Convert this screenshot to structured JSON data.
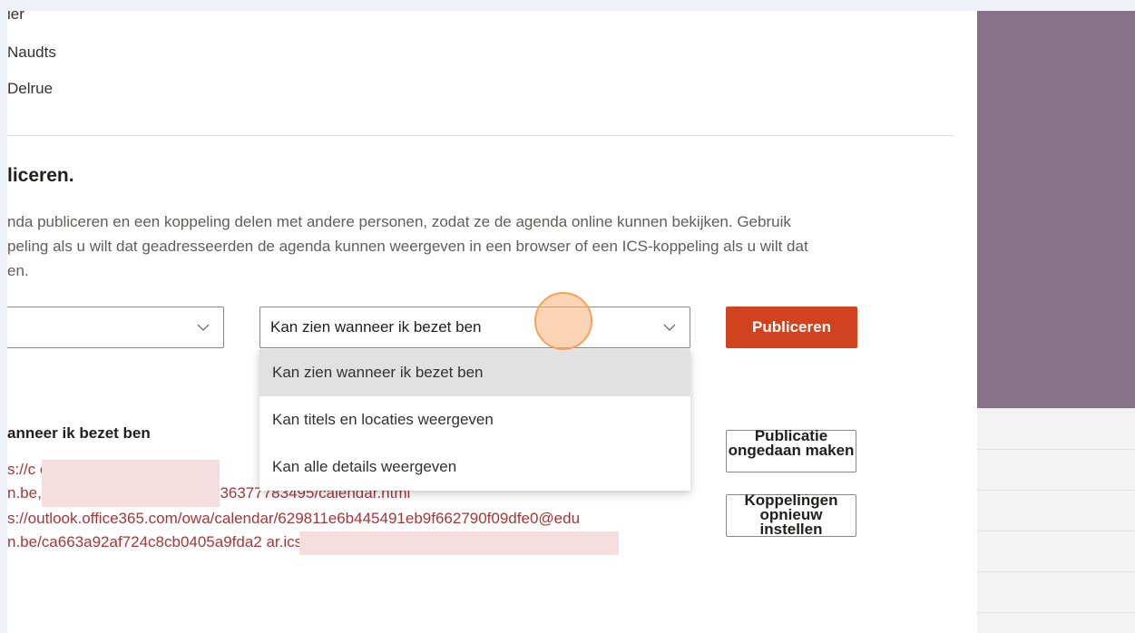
{
  "people": [
    "ier",
    "Naudts",
    "Delrue"
  ],
  "section": {
    "heading": "liceren.",
    "description": [
      "nda publiceren en een koppeling delen met andere personen, zodat ze de agenda online kunnen bekijken. Gebruik",
      "peling als u wilt dat geadresseerden de agenda kunnen weergeven in een browser of een ICS-koppeling als u wilt dat",
      "en."
    ]
  },
  "calendar_select": {
    "value": ""
  },
  "permission_select": {
    "value": "Kan zien wanneer ik bezet ben"
  },
  "publish_button": "Publiceren",
  "dropdown": {
    "options": [
      "Kan zien wanneer ik bezet ben",
      "Kan titels en locaties weergeven",
      "Kan alle details weergeven"
    ],
    "selected_index": 0
  },
  "published": {
    "heading": "anneer ik bezet ben",
    "links": [
      "s://c                                 owa/c",
      "n.be,                                 05a9fda2a0cc0346543613637778349​5/calendar.html",
      "s://outlook.office365.com/owa/calendar/629811e6b445491eb9f662790f09dfe0@edu",
      "n.be/ca663a92af724c8cb0405a9fda2                                   ar.ics"
    ],
    "undo_button": "Publicatie ongedaan maken",
    "reset_button": "Koppelingen opnieuw instellen"
  },
  "colors": {
    "accent": "#d1431f",
    "link": "#a4373a",
    "side_panel": "#877189"
  }
}
